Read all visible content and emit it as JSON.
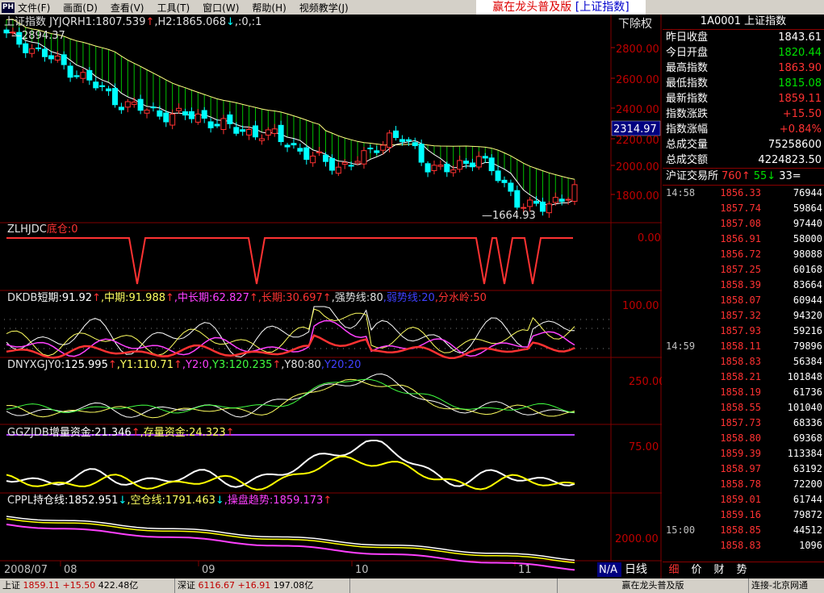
{
  "menubar": {
    "logo": "PH",
    "items": [
      "文件(F)",
      "画面(D)",
      "查看(V)",
      "工具(T)",
      "窗口(W)",
      "帮助(H)",
      "视频教学(J)"
    ],
    "banner_prefix": "赢在龙头普及版",
    "banner_suffix": "[上证指数]"
  },
  "main_panel": {
    "title": "上证指数 JYJQRH1:1807.539",
    "arrow1": "↑",
    "h2": ",H2:1865.068",
    "arrow2": "↓",
    ",rest": ",:0,:1",
    "high_note": "—2894.37",
    "low_note": "—1664.93",
    "restore_label": "下除权",
    "price_marker": "2314.97",
    "y_ticks": [
      "2800.00",
      "2600.00",
      "2400.00",
      "2200.00",
      "2000.00",
      "1800.00"
    ]
  },
  "zlhjdc": {
    "name": "ZLHJDC",
    "label": "底仓:0",
    "y_tick": "0.00"
  },
  "dkdb": {
    "name": "DKDB",
    "items": [
      "短期:91.92",
      "↑",
      ",中期:91.988",
      "↑",
      ",中长期:62.827",
      "↑",
      ",长期:30.697",
      "↑",
      ",强势线:80",
      ",弱势线:20",
      ",分水岭:50"
    ],
    "y_tick": "100.00"
  },
  "dnyxg": {
    "name": "DNYXGJY0",
    "items": [
      ":125.995",
      "↑",
      ",Y1:110.71",
      "↑",
      ",Y2:0",
      ",Y3:120.235",
      "↑",
      ",Y80:80",
      ",Y20:20"
    ],
    "y_tick": "250.00"
  },
  "ggzjdb": {
    "name": "GGZJDB",
    "items": [
      "增量资金:21.346",
      "↑",
      ",存量资金:24.323",
      "↑"
    ],
    "y_tick": "75.00"
  },
  "cppl": {
    "name": "CPPL",
    "items": [
      "持仓线:1852.951",
      "↓",
      ",空仓线:1791.463",
      "↓",
      ",操盘趋势:1859.173",
      "↑"
    ],
    "y_tick": "2000.00"
  },
  "x_axis": {
    "labels": [
      "2008/07",
      "08",
      "09",
      "10",
      "11"
    ],
    "na": "N/A",
    "period": "日线"
  },
  "right_panel": {
    "header": "1A0001 上证指数",
    "stats": [
      {
        "label": "昨日收盘",
        "value": "1843.61",
        "color": "#ffffff"
      },
      {
        "label": "今日开盘",
        "value": "1820.44",
        "color": "#00e000"
      },
      {
        "label": "最高指数",
        "value": "1863.90",
        "color": "#ff3232"
      },
      {
        "label": "最低指数",
        "value": "1815.08",
        "color": "#00e000"
      },
      {
        "label": "最新指数",
        "value": "1859.11",
        "color": "#ff3232"
      },
      {
        "label": "指数涨跌",
        "value": "+15.50",
        "color": "#ff3232"
      },
      {
        "label": "指数涨幅",
        "value": "+0.84%",
        "color": "#ff3232"
      },
      {
        "label": "总成交量",
        "value": "75258600",
        "color": "#ffffff"
      },
      {
        "label": "总成交额",
        "value": "4224823.50",
        "color": "#ffffff"
      }
    ],
    "exchange": {
      "name": "沪证交易所",
      "up": "760",
      "up_arrow": "↑",
      "down": "55",
      "down_arrow": "↓",
      "flat": "33="
    },
    "ticks": [
      {
        "t": "14:58",
        "p": "1856.33",
        "v": "76944"
      },
      {
        "t": "",
        "p": "1857.74",
        "v": "59864"
      },
      {
        "t": "",
        "p": "1857.08",
        "v": "97440"
      },
      {
        "t": "",
        "p": "1856.91",
        "v": "58000"
      },
      {
        "t": "",
        "p": "1856.72",
        "v": "98088"
      },
      {
        "t": "",
        "p": "1857.25",
        "v": "60168"
      },
      {
        "t": "",
        "p": "1858.39",
        "v": "83664"
      },
      {
        "t": "",
        "p": "1858.07",
        "v": "60944"
      },
      {
        "t": "",
        "p": "1857.32",
        "v": "94320"
      },
      {
        "t": "",
        "p": "1857.93",
        "v": "59216"
      },
      {
        "t": "14:59",
        "p": "1858.11",
        "v": "79896"
      },
      {
        "t": "",
        "p": "1858.83",
        "v": "56384"
      },
      {
        "t": "",
        "p": "1858.21",
        "v": "101848"
      },
      {
        "t": "",
        "p": "1858.19",
        "v": "61736"
      },
      {
        "t": "",
        "p": "1858.55",
        "v": "101040"
      },
      {
        "t": "",
        "p": "1857.73",
        "v": "68336"
      },
      {
        "t": "",
        "p": "1858.80",
        "v": "69368"
      },
      {
        "t": "",
        "p": "1859.39",
        "v": "113384"
      },
      {
        "t": "",
        "p": "1858.97",
        "v": "63192"
      },
      {
        "t": "",
        "p": "1858.78",
        "v": "72200"
      },
      {
        "t": "",
        "p": "1859.01",
        "v": "61744"
      },
      {
        "t": "",
        "p": "1859.16",
        "v": "79872"
      },
      {
        "t": "15:00",
        "p": "1858.85",
        "v": "44512"
      },
      {
        "t": "",
        "p": "1858.83",
        "v": "1096"
      }
    ],
    "tabs": [
      "细",
      "价",
      "财",
      "势"
    ]
  },
  "status": {
    "sh_label": "上证",
    "sh_value": "1859.11",
    "sh_change": "+15.50",
    "sh_amount": "422.48亿",
    "sz_label": "深证",
    "sz_value": "6116.67",
    "sz_change": "+16.91",
    "sz_amount": "197.08亿",
    "banner": "赢在龙头普及版",
    "conn": "连接-北京网通"
  },
  "colors": {
    "up": "#ff3232",
    "down": "#00ffff",
    "ma": "#ffff80",
    "fill": "#00c000",
    "grid": "#800000",
    "axis": "#c00000",
    "white": "#ffffff",
    "yellow": "#ffff00",
    "magenta": "#ff40ff",
    "green": "#40ff40",
    "blue": "#4040ff",
    "purple": "#b040ff"
  }
}
